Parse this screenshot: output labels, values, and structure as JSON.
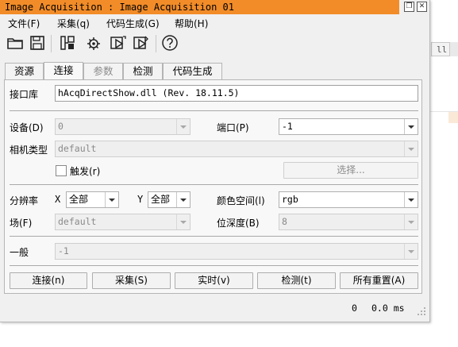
{
  "window": {
    "title": "Image Acquisition : Image Acquisition 01"
  },
  "menu": [
    {
      "label": "文件(F)"
    },
    {
      "label": "采集(q)"
    },
    {
      "label": "代码生成(G)"
    },
    {
      "label": "帮助(H)"
    }
  ],
  "toolbar": {
    "icons": [
      "open-folder-icon",
      "save-icon",
      "connect-icon",
      "settings-gear-icon",
      "snap-icon",
      "live-icon",
      "help-icon"
    ]
  },
  "tabs": [
    {
      "label": "资源",
      "state": "normal"
    },
    {
      "label": "连接",
      "state": "active"
    },
    {
      "label": "参数",
      "state": "disabled"
    },
    {
      "label": "检测",
      "state": "normal"
    },
    {
      "label": "代码生成",
      "state": "normal"
    }
  ],
  "connection": {
    "interface_label": "接口库",
    "interface_value": "hAcqDirectShow.dll (Rev. 18.11.5)",
    "device_label": "设备(D)",
    "device_value": "0",
    "port_label": "端口(P)",
    "port_value": "-1",
    "camera_type_label": "相机类型",
    "camera_type_value": "default",
    "trigger_label": "触发(r)",
    "trigger_checked": false,
    "select_button": "选择...",
    "resolution_label": "分辨率",
    "res_x_label": "X",
    "res_x_value": "全部",
    "res_y_label": "Y",
    "res_y_value": "全部",
    "color_space_label": "颜色空间(l)",
    "color_space_value": "rgb",
    "field_label": "场(F)",
    "field_value": "default",
    "bit_depth_label": "位深度(B)",
    "bit_depth_value": "8",
    "general_label": "一般",
    "general_value": "-1"
  },
  "buttons": {
    "connect": "连接(n)",
    "snap": "采集(S)",
    "live": "实时(v)",
    "detect": "检测(t)",
    "reset_all": "所有重置(A)"
  },
  "status": {
    "frame_count": "0",
    "time": "0.0 ms"
  },
  "background": {
    "tab_fragment": "ll"
  },
  "colors": {
    "title_bar": "#f28c28"
  }
}
